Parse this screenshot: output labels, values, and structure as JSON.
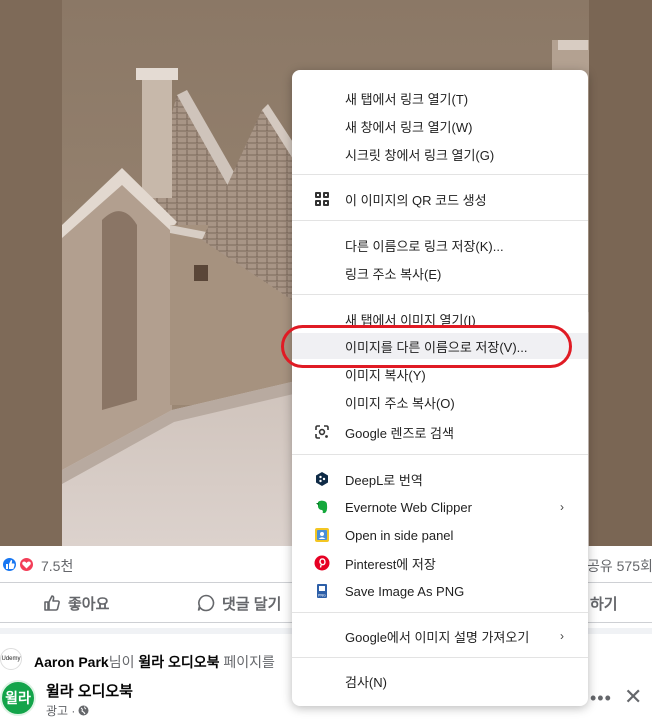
{
  "reactions": {
    "count": "7.5천",
    "share_count": "공유 575회"
  },
  "actions": {
    "like_label": "좋아요",
    "comment_label": "댓글 달기",
    "share_label": "하기"
  },
  "post": {
    "activity_user": "Aaron Park",
    "activity_connector": "님이",
    "activity_page": "윌라 오디오북",
    "activity_suffix": "페이지를",
    "udemy_label": "Udemy",
    "page_avatar_text": "윌라",
    "page_name": "윌라 오디오북",
    "sponsored": "광고 ·",
    "more_icon": "more-horizontal-icon",
    "close_icon": "close-icon"
  },
  "context_menu": {
    "open_link_new_tab": "새 탭에서 링크 열기(T)",
    "open_link_new_window": "새 창에서 링크 열기(W)",
    "open_link_incognito": "시크릿 창에서 링크 열기(G)",
    "create_qr": "이 이미지의 QR 코드 생성",
    "save_link_as": "다른 이름으로 링크 저장(K)...",
    "copy_link_address": "링크 주소 복사(E)",
    "open_image_new_tab": "새 탭에서 이미지 열기(I)",
    "save_image_as": "이미지를 다른 이름으로 저장(V)...",
    "copy_image": "이미지 복사(Y)",
    "copy_image_address": "이미지 주소 복사(O)",
    "google_lens": "Google 렌즈로 검색",
    "deepl_translate": "DeepL로 번역",
    "evernote_clipper": "Evernote Web Clipper",
    "open_side_panel": "Open in side panel",
    "pinterest_save": "Pinterest에 저장",
    "save_image_png": "Save Image As PNG",
    "google_image_description": "Google에서 이미지 설명 가져오기",
    "inspect": "검사(N)"
  },
  "colors": {
    "highlight_circle": "#e01b24",
    "facebook_blue": "#1877f2",
    "love_red": "#f33e58",
    "page_green": "#13a44a"
  }
}
